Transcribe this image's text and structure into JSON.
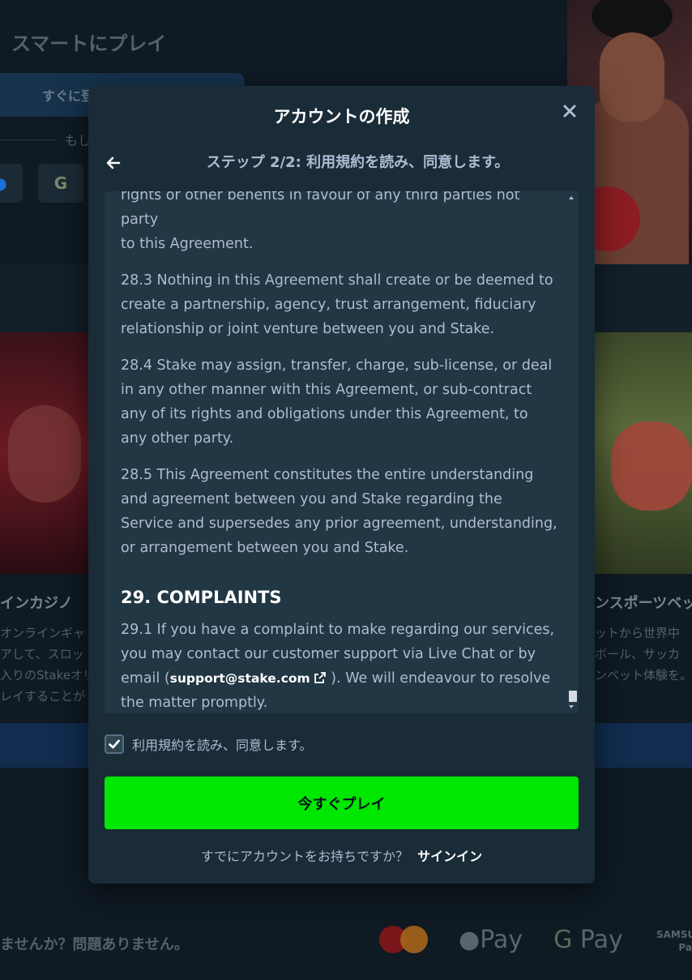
{
  "background": {
    "title": "スマートにプレイ",
    "cta_button": "すぐに登",
    "or_text": "もし",
    "social_google": "G",
    "social_other": "",
    "left_card_caption": "インカジノ",
    "left_card_desc": [
      "オンラインギャ",
      "アして、スロッ",
      "入りのStakeオリ",
      "レイすることが"
    ],
    "right_card_caption": "ンスポーツベッ",
    "right_card_desc": [
      "ットから世界中",
      "ボール、サッカ",
      "ンベット体験を。"
    ],
    "footer_text": "ませんか？問題ありません。",
    "payments": {
      "apple_pay": "Pay",
      "google_pay": "Pay",
      "samsung": "SAMSU",
      "samsung_sub": "Pa"
    }
  },
  "modal": {
    "title": "アカウントの作成",
    "step_title": "ステップ 2/2: 利用規約を読み、同意します。",
    "terms": {
      "cut_top": "rights or other benefits in favour of any third parties not party",
      "p1": "to this Agreement.",
      "p2": "28.3 Nothing in this Agreement shall create or be deemed to create a partnership, agency, trust arrangement, fiduciary relationship or joint venture between you and Stake.",
      "p3": "28.4 Stake may assign, transfer, charge, sub-license, or deal in any other manner with this Agreement, or sub-contract any of its rights and obligations under this Agreement, to any other party.",
      "p4": "28.5 This Agreement constitutes the entire understanding and agreement between you and Stake regarding the Service and supersedes any prior agreement, understanding, or arrangement between you and Stake.",
      "heading": "29. COMPLAINTS",
      "p5_start": "29.1 If you have a complaint to make regarding our services, you may contact our customer support via Live Chat or by email (",
      "email": "support@stake.com",
      "p5_end": " ). We will endeavour to resolve the matter promptly."
    },
    "agree_label": "利用規約を読み、同意します。",
    "agree_checked": true,
    "play_button": "今すぐプレイ",
    "signin_prompt": "すでにアカウントをお持ちですか？",
    "signin_link": "サインイン"
  },
  "colors": {
    "modal_bg": "#1a2c38",
    "terms_bg": "#213743",
    "primary_button": "#00e701",
    "text_muted": "#b1bad3"
  }
}
